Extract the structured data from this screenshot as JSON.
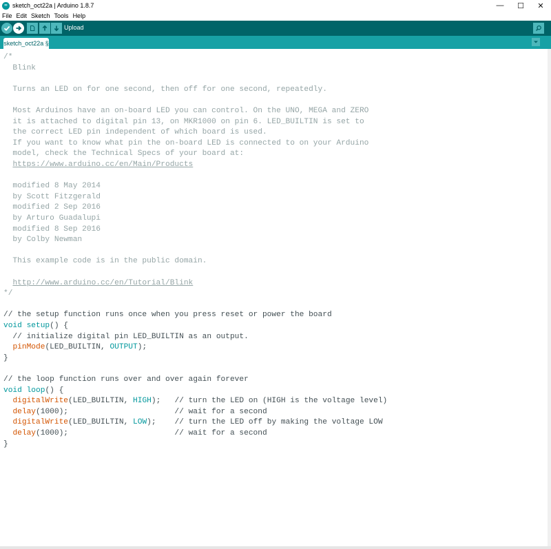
{
  "window": {
    "title": "sketch_oct22a | Arduino 1.8.7",
    "logo_text": "∞",
    "controls": {
      "minimize": "—",
      "maximize": "☐",
      "close": "✕"
    }
  },
  "menu": {
    "items": [
      "File",
      "Edit",
      "Sketch",
      "Tools",
      "Help"
    ]
  },
  "toolbar": {
    "hover_label": "Upload",
    "buttons": [
      "check-icon",
      "arrow-right-icon",
      "new-file-icon",
      "arrow-up-icon",
      "arrow-down-icon"
    ],
    "serial_monitor_icon": "magnifier-icon"
  },
  "tab": {
    "label": "sketch_oct22a §"
  },
  "colors": {
    "toolbar_bg": "#006468",
    "tab_bar_bg": "#17a1a5",
    "button_bg": "#4db7bb",
    "comment": "#95a5a6",
    "keyword": "#00979c",
    "function": "#d35400",
    "text": "#434f54"
  },
  "code": [
    {
      "line": 1,
      "segments": [
        {
          "t": "/*",
          "c": "comment"
        }
      ]
    },
    {
      "line": 2,
      "segments": [
        {
          "t": "  Blink",
          "c": "comment"
        }
      ]
    },
    {
      "line": 3,
      "segments": []
    },
    {
      "line": 4,
      "segments": [
        {
          "t": "  Turns an LED on for one second, then off for one second, repeatedly.",
          "c": "comment"
        }
      ]
    },
    {
      "line": 5,
      "segments": []
    },
    {
      "line": 6,
      "segments": [
        {
          "t": "  Most Arduinos have an on-board LED you can control. On the UNO, MEGA and ZERO",
          "c": "comment"
        }
      ]
    },
    {
      "line": 7,
      "segments": [
        {
          "t": "  it is attached to digital pin 13, on MKR1000 on pin 6. LED_BUILTIN is set to",
          "c": "comment"
        }
      ]
    },
    {
      "line": 8,
      "segments": [
        {
          "t": "  the correct LED pin independent of which board is used.",
          "c": "comment"
        }
      ]
    },
    {
      "line": 9,
      "segments": [
        {
          "t": "  If you want to know what pin the on-board LED is connected to on your Arduino",
          "c": "comment"
        }
      ]
    },
    {
      "line": 10,
      "segments": [
        {
          "t": "  model, check the Technical Specs of your board at:",
          "c": "comment"
        }
      ]
    },
    {
      "line": 11,
      "segments": [
        {
          "t": "  ",
          "c": "comment"
        },
        {
          "t": "https://www.arduino.cc/en/Main/Products",
          "c": "link"
        }
      ]
    },
    {
      "line": 12,
      "segments": []
    },
    {
      "line": 13,
      "segments": [
        {
          "t": "  modified 8 May 2014",
          "c": "comment"
        }
      ]
    },
    {
      "line": 14,
      "segments": [
        {
          "t": "  by Scott Fitzgerald",
          "c": "comment"
        }
      ]
    },
    {
      "line": 15,
      "segments": [
        {
          "t": "  modified 2 Sep 2016",
          "c": "comment"
        }
      ]
    },
    {
      "line": 16,
      "segments": [
        {
          "t": "  by Arturo Guadalupi",
          "c": "comment"
        }
      ]
    },
    {
      "line": 17,
      "segments": [
        {
          "t": "  modified 8 Sep 2016",
          "c": "comment"
        }
      ]
    },
    {
      "line": 18,
      "segments": [
        {
          "t": "  by Colby Newman",
          "c": "comment"
        }
      ]
    },
    {
      "line": 19,
      "segments": []
    },
    {
      "line": 20,
      "segments": [
        {
          "t": "  This example code is in the public domain.",
          "c": "comment"
        }
      ]
    },
    {
      "line": 21,
      "segments": []
    },
    {
      "line": 22,
      "segments": [
        {
          "t": "  ",
          "c": "comment"
        },
        {
          "t": "http://www.arduino.cc/en/Tutorial/Blink",
          "c": "link"
        }
      ]
    },
    {
      "line": 23,
      "segments": [
        {
          "t": "*/",
          "c": "comment"
        }
      ]
    },
    {
      "line": 24,
      "segments": []
    },
    {
      "line": 25,
      "segments": [
        {
          "t": "// the setup function runs once when you press reset or power the board",
          "c": "text"
        }
      ]
    },
    {
      "line": 26,
      "segments": [
        {
          "t": "void",
          "c": "kw"
        },
        {
          "t": " ",
          "c": "text"
        },
        {
          "t": "setup",
          "c": "kw"
        },
        {
          "t": "() {",
          "c": "text"
        }
      ]
    },
    {
      "line": 27,
      "segments": [
        {
          "t": "  // initialize digital pin LED_BUILTIN as an output.",
          "c": "text"
        }
      ]
    },
    {
      "line": 28,
      "segments": [
        {
          "t": "  ",
          "c": "text"
        },
        {
          "t": "pinMode",
          "c": "fn"
        },
        {
          "t": "(LED_BUILTIN, ",
          "c": "text"
        },
        {
          "t": "OUTPUT",
          "c": "const"
        },
        {
          "t": ");",
          "c": "text"
        }
      ]
    },
    {
      "line": 29,
      "segments": [
        {
          "t": "}",
          "c": "text"
        }
      ]
    },
    {
      "line": 30,
      "segments": []
    },
    {
      "line": 31,
      "segments": [
        {
          "t": "// the loop function runs over and over again forever",
          "c": "text"
        }
      ]
    },
    {
      "line": 32,
      "segments": [
        {
          "t": "void",
          "c": "kw"
        },
        {
          "t": " ",
          "c": "text"
        },
        {
          "t": "loop",
          "c": "kw"
        },
        {
          "t": "() {",
          "c": "text"
        }
      ]
    },
    {
      "line": 33,
      "segments": [
        {
          "t": "  ",
          "c": "text"
        },
        {
          "t": "digitalWrite",
          "c": "fn"
        },
        {
          "t": "(LED_BUILTIN, ",
          "c": "text"
        },
        {
          "t": "HIGH",
          "c": "const"
        },
        {
          "t": ");   // turn the LED on (HIGH is the voltage level)",
          "c": "text"
        }
      ]
    },
    {
      "line": 34,
      "segments": [
        {
          "t": "  ",
          "c": "text"
        },
        {
          "t": "delay",
          "c": "fn"
        },
        {
          "t": "(1000);                       // wait for a second",
          "c": "text"
        }
      ]
    },
    {
      "line": 35,
      "segments": [
        {
          "t": "  ",
          "c": "text"
        },
        {
          "t": "digitalWrite",
          "c": "fn"
        },
        {
          "t": "(LED_BUILTIN, ",
          "c": "text"
        },
        {
          "t": "LOW",
          "c": "const"
        },
        {
          "t": ");    // turn the LED off by making the voltage LOW",
          "c": "text"
        }
      ]
    },
    {
      "line": 36,
      "segments": [
        {
          "t": "  ",
          "c": "text"
        },
        {
          "t": "delay",
          "c": "fn"
        },
        {
          "t": "(1000);                       // wait for a second",
          "c": "text"
        }
      ]
    },
    {
      "line": 37,
      "segments": [
        {
          "t": "}",
          "c": "text"
        }
      ]
    }
  ]
}
